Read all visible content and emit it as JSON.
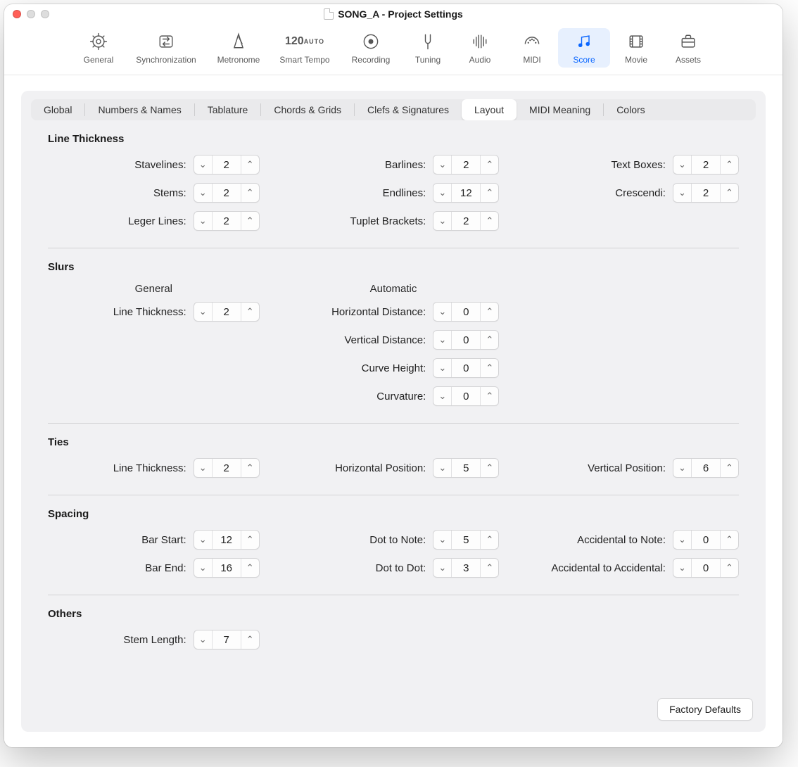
{
  "window": {
    "title": "SONG_A - Project Settings"
  },
  "toolbar": [
    {
      "key": "general",
      "label": "General"
    },
    {
      "key": "synchronization",
      "label": "Synchronization"
    },
    {
      "key": "metronome",
      "label": "Metronome"
    },
    {
      "key": "smart-tempo",
      "label": "Smart Tempo",
      "tempo": "120",
      "mode": "AUTO"
    },
    {
      "key": "recording",
      "label": "Recording"
    },
    {
      "key": "tuning",
      "label": "Tuning"
    },
    {
      "key": "audio",
      "label": "Audio"
    },
    {
      "key": "midi",
      "label": "MIDI"
    },
    {
      "key": "score",
      "label": "Score",
      "selected": true
    },
    {
      "key": "movie",
      "label": "Movie"
    },
    {
      "key": "assets",
      "label": "Assets"
    }
  ],
  "subtabs": [
    {
      "key": "global",
      "label": "Global"
    },
    {
      "key": "numbers-names",
      "label": "Numbers & Names"
    },
    {
      "key": "tablature",
      "label": "Tablature"
    },
    {
      "key": "chords-grids",
      "label": "Chords & Grids"
    },
    {
      "key": "clefs-signatures",
      "label": "Clefs & Signatures"
    },
    {
      "key": "layout",
      "label": "Layout",
      "selected": true
    },
    {
      "key": "midi-meaning",
      "label": "MIDI Meaning"
    },
    {
      "key": "colors",
      "label": "Colors"
    }
  ],
  "sections": {
    "line_thickness": {
      "title": "Line Thickness",
      "stavelines": {
        "label": "Stavelines:",
        "value": 2
      },
      "stems": {
        "label": "Stems:",
        "value": 2
      },
      "leger_lines": {
        "label": "Leger Lines:",
        "value": 2
      },
      "barlines": {
        "label": "Barlines:",
        "value": 2
      },
      "endlines": {
        "label": "Endlines:",
        "value": 12
      },
      "tuplet_brackets": {
        "label": "Tuplet Brackets:",
        "value": 2
      },
      "text_boxes": {
        "label": "Text Boxes:",
        "value": 2
      },
      "crescendi": {
        "label": "Crescendi:",
        "value": 2
      }
    },
    "slurs": {
      "title": "Slurs",
      "col_general": "General",
      "col_automatic": "Automatic",
      "line_thickness": {
        "label": "Line Thickness:",
        "value": 2
      },
      "horizontal_distance": {
        "label": "Horizontal Distance:",
        "value": 0
      },
      "vertical_distance": {
        "label": "Vertical Distance:",
        "value": 0
      },
      "curve_height": {
        "label": "Curve Height:",
        "value": 0
      },
      "curvature": {
        "label": "Curvature:",
        "value": 0
      }
    },
    "ties": {
      "title": "Ties",
      "line_thickness": {
        "label": "Line Thickness:",
        "value": 2
      },
      "horizontal_position": {
        "label": "Horizontal Position:",
        "value": 5
      },
      "vertical_position": {
        "label": "Vertical Position:",
        "value": 6
      }
    },
    "spacing": {
      "title": "Spacing",
      "bar_start": {
        "label": "Bar Start:",
        "value": 12
      },
      "bar_end": {
        "label": "Bar End:",
        "value": 16
      },
      "dot_to_note": {
        "label": "Dot to Note:",
        "value": 5
      },
      "dot_to_dot": {
        "label": "Dot to Dot:",
        "value": 3
      },
      "accidental_to_note": {
        "label": "Accidental to Note:",
        "value": 0
      },
      "accidental_to_accidental": {
        "label": "Accidental to Accidental:",
        "value": 0
      }
    },
    "others": {
      "title": "Others",
      "stem_length": {
        "label": "Stem Length:",
        "value": 7
      }
    }
  },
  "buttons": {
    "factory_defaults": "Factory Defaults"
  }
}
